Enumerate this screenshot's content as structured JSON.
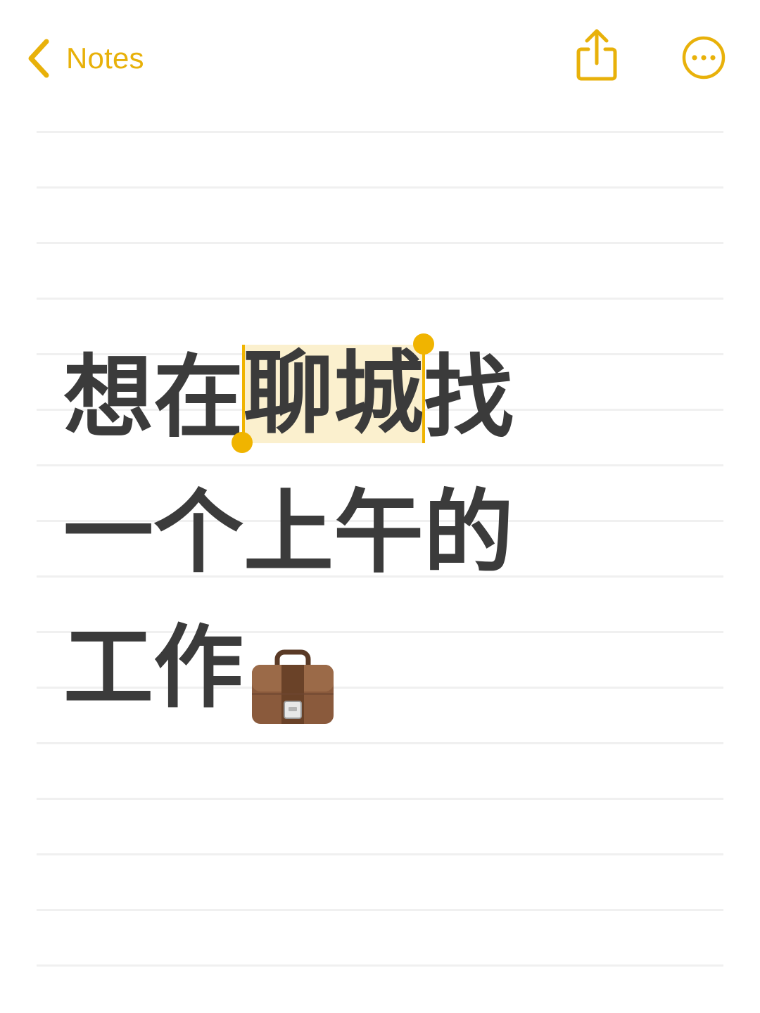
{
  "nav": {
    "back_label": "Notes",
    "back_icon": "chevron-left-icon",
    "share_icon": "share-icon",
    "more_icon": "ellipsis-circle-icon"
  },
  "colors": {
    "accent": "#E8B10A",
    "text": "#3b3b3b",
    "selection": "#FBF0CE",
    "rule": "#F0F0F0"
  },
  "note": {
    "line1_before": "想在",
    "line1_selected": "聊城",
    "line1_after": "找",
    "line2": "一个上午的",
    "line3": "工作",
    "line3_icon": "briefcase-icon"
  }
}
